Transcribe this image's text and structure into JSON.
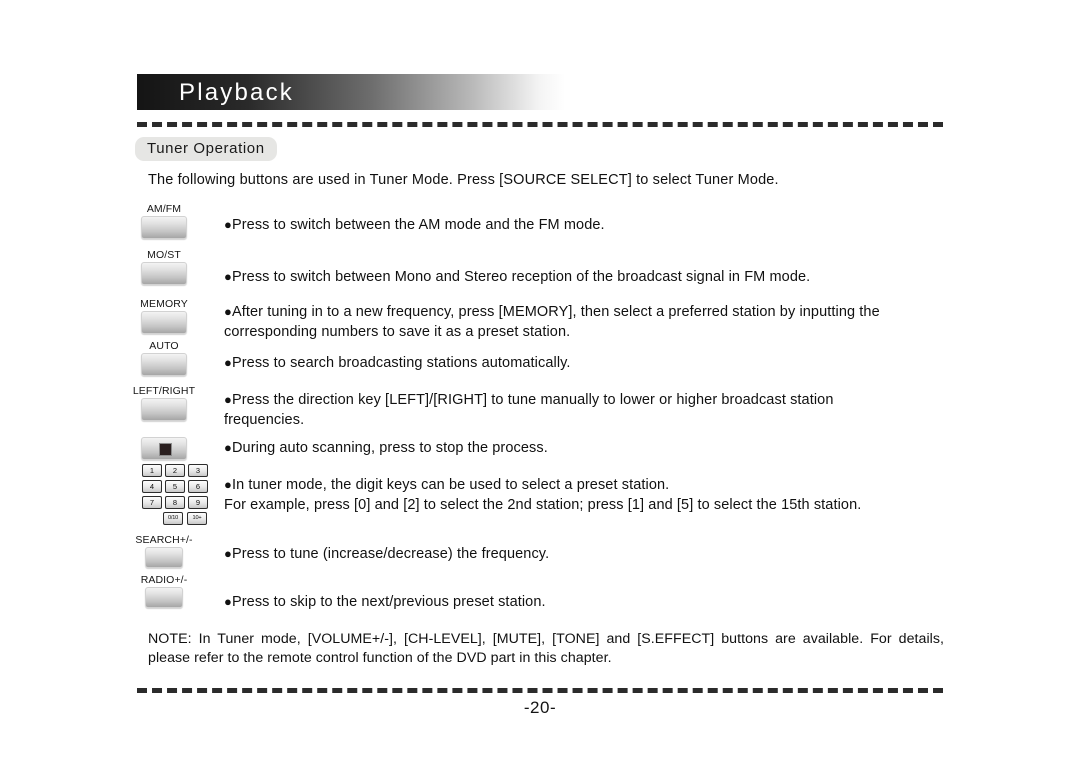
{
  "header": {
    "banner_title": "Playback"
  },
  "section": {
    "label": "Tuner Operation"
  },
  "intro": "The following buttons are used in Tuner Mode. Press [SOURCE SELECT] to select Tuner Mode.",
  "buttons": [
    {
      "name": "am-fm",
      "label": "AM/FM",
      "style": "wide"
    },
    {
      "name": "mo-st",
      "label": "MO/ST",
      "style": "wide"
    },
    {
      "name": "memory",
      "label": "MEMORY",
      "style": "wide"
    },
    {
      "name": "auto",
      "label": "AUTO",
      "style": "wide"
    },
    {
      "name": "left-right",
      "label": "LEFT/RIGHT",
      "style": "wide"
    },
    {
      "name": "stop",
      "label": "",
      "style": "stop"
    },
    {
      "name": "search-plus-minus",
      "label": "SEARCH+/-",
      "style": "narrow"
    },
    {
      "name": "radio-plus-minus",
      "label": "RADIO+/-",
      "style": "narrow"
    }
  ],
  "keypad": {
    "rows": [
      [
        "1",
        "2",
        "3"
      ],
      [
        "4",
        "5",
        "6"
      ],
      [
        "7",
        "8",
        "9"
      ]
    ],
    "last_row": [
      "0/10",
      "10+"
    ]
  },
  "bullets": [
    {
      "name": "am-fm",
      "line1": "Press to switch between the AM mode and the FM mode.",
      "line2": ""
    },
    {
      "name": "mo-st",
      "line1": "Press to switch between Mono and Stereo reception of the broadcast signal in FM mode.",
      "line2": ""
    },
    {
      "name": "memory",
      "line1": "After tuning in to a new frequency, press [MEMORY], then select a preferred station by inputting the",
      "line2": "corresponding numbers to save it as a preset station."
    },
    {
      "name": "auto",
      "line1": "Press to search broadcasting stations automatically.",
      "line2": ""
    },
    {
      "name": "left-right",
      "line1": "Press the direction key [LEFT]/[RIGHT] to tune manually to lower or higher broadcast station",
      "line2": "frequencies."
    },
    {
      "name": "stop",
      "line1": "During auto scanning, press to stop the process.",
      "line2": ""
    },
    {
      "name": "digit-keys",
      "line1": "In tuner mode, the digit keys can be used to select a preset station.",
      "line2": "For example, press [0] and [2] to select the 2nd station; press [1] and [5] to select the 15th station."
    },
    {
      "name": "search",
      "line1": "Press to tune (increase/decrease) the frequency.",
      "line2": ""
    },
    {
      "name": "radio",
      "line1": "Press to skip to the next/previous preset station.",
      "line2": ""
    }
  ],
  "note": {
    "line1": "NOTE: In Tuner mode, [VOLUME+/-], [CH-LEVEL], [MUTE], [TONE] and [S.EFFECT] buttons are available. For",
    "line2": "details, please refer to the remote control function of the DVD part in this chapter."
  },
  "footer": {
    "page_number": "-20-"
  },
  "colors": {
    "banner_dark": "#141414",
    "pill_bg": "#e6e6e4",
    "text": "#111111",
    "rule": "#2b2b2b"
  }
}
